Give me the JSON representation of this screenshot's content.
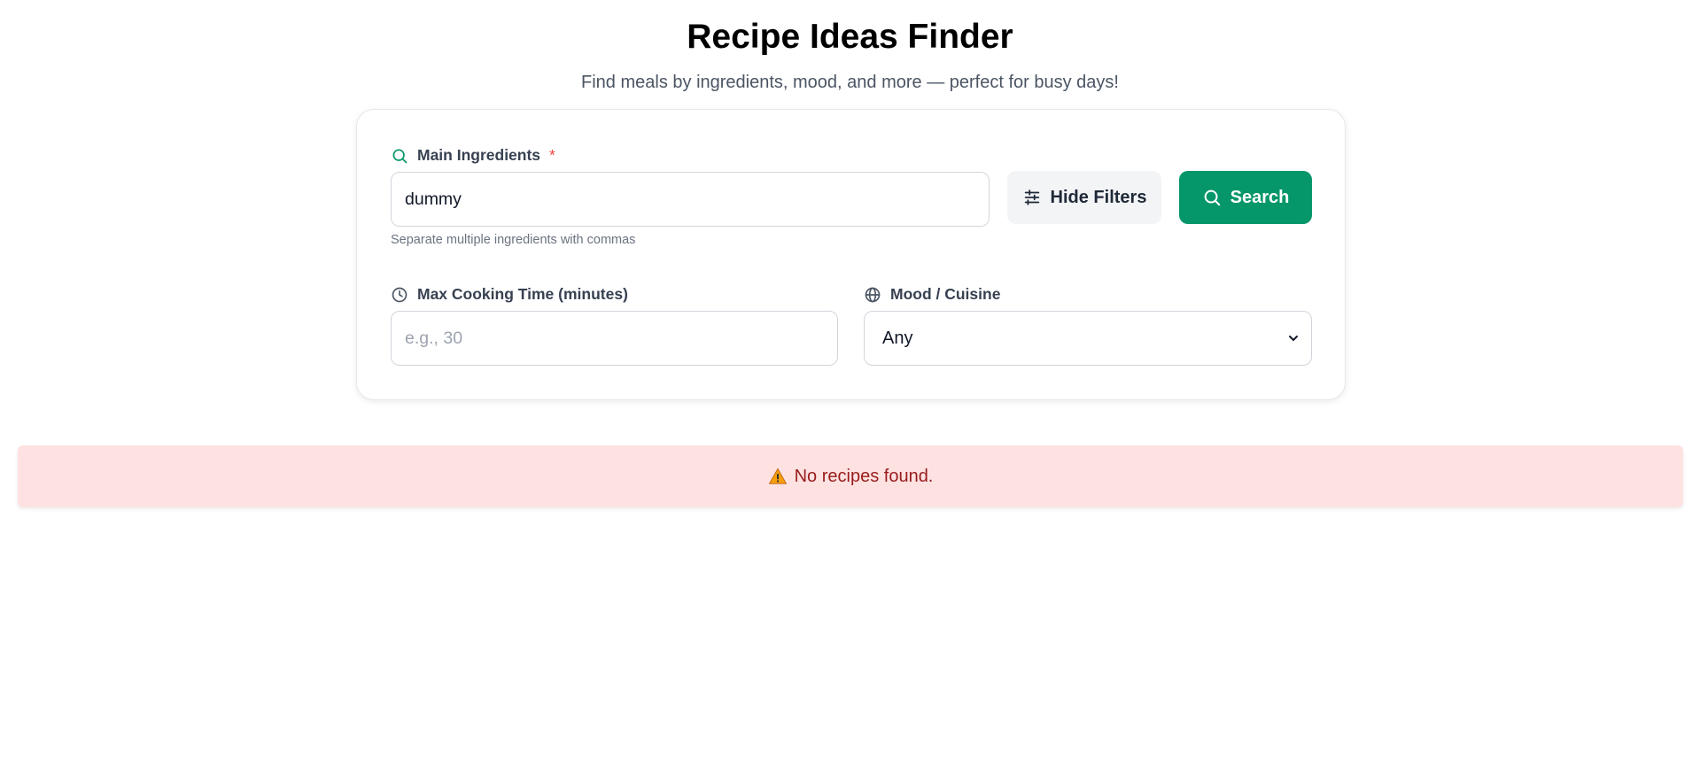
{
  "header": {
    "title": "Recipe Ideas Finder",
    "subtitle": "Find meals by ingredients, mood, and more — perfect for busy days!"
  },
  "form": {
    "ingredients": {
      "label": "Main Ingredients",
      "required_mark": "*",
      "value": "dummy",
      "hint": "Separate multiple ingredients with commas",
      "icon": "search-icon"
    },
    "filters_button": {
      "label": "Hide Filters",
      "icon": "sliders-icon"
    },
    "search_button": {
      "label": "Search",
      "icon": "search-icon"
    },
    "cooking_time": {
      "label": "Max Cooking Time (minutes)",
      "value": "",
      "placeholder": "e.g., 30",
      "icon": "clock-icon"
    },
    "mood": {
      "label": "Mood / Cuisine",
      "selected": "Any",
      "icon": "globe-icon"
    }
  },
  "alert": {
    "message": "No recipes found.",
    "icon": "warning-icon"
  },
  "colors": {
    "accent": "#059669",
    "alert_bg": "#fee2e2",
    "alert_text": "#991b1b",
    "required": "#ef4444"
  }
}
